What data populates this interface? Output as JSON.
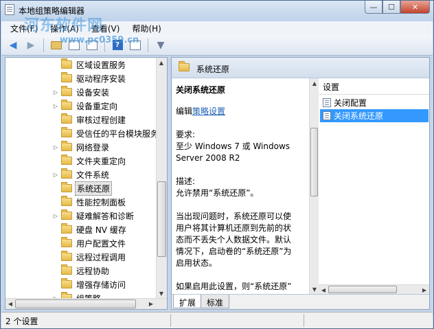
{
  "window": {
    "title": "本地组策略编辑器",
    "watermark": "河东软件网",
    "watermark_url": "www.pc0359.cn",
    "controls": {
      "minimize": "—",
      "maximize": "☐",
      "close": "✕"
    }
  },
  "menu": [
    "文件(F)",
    "操作(A)",
    "查看(V)",
    "帮助(H)"
  ],
  "toolbar": {
    "icons": [
      "back-arrow-icon",
      "forward-arrow-icon",
      "folder-up-icon",
      "show-hide-tree-icon",
      "properties-icon",
      "help-icon",
      "show-pane-icon",
      "filter-icon"
    ]
  },
  "tree": {
    "items": [
      {
        "label": "区域设置服务",
        "expandable": false
      },
      {
        "label": "驱动程序安装",
        "expandable": false
      },
      {
        "label": "设备安装",
        "expandable": true
      },
      {
        "label": "设备重定向",
        "expandable": true
      },
      {
        "label": "审核过程创建",
        "expandable": false
      },
      {
        "label": "受信任的平台模块服务",
        "expandable": false
      },
      {
        "label": "网络登录",
        "expandable": true
      },
      {
        "label": "文件夹重定向",
        "expandable": false
      },
      {
        "label": "文件系统",
        "expandable": true
      },
      {
        "label": "系统还原",
        "expandable": false,
        "selected": true
      },
      {
        "label": "性能控制面板",
        "expandable": false
      },
      {
        "label": "疑难解答和诊断",
        "expandable": true
      },
      {
        "label": "硬盘 NV 缓存",
        "expandable": false
      },
      {
        "label": "用户配置文件",
        "expandable": false
      },
      {
        "label": "远程过程调用",
        "expandable": false
      },
      {
        "label": "远程协助",
        "expandable": false
      },
      {
        "label": "增强存储访问",
        "expandable": false
      },
      {
        "label": "组策略",
        "expandable": true
      }
    ]
  },
  "right_pane": {
    "header": "系统还原",
    "description": {
      "title": "关闭系统还原",
      "edit_prefix": "编辑",
      "edit_link": "策略设置",
      "requirements_label": "要求:",
      "requirements": "至少 Windows 7 或 Windows Server 2008 R2",
      "description_label": "描述:",
      "description_text": "允许禁用“系统还原”。",
      "detail": "当出现问题时，系统还原可以使用户将其计算机还原到先前的状态而不丢失个人数据文件。默认情况下，启动卷的“系统还原”为启用状态。",
      "detail2": "如果启用此设置，则“系统还原”"
    },
    "list": {
      "header": "设置",
      "items": [
        {
          "label": "关闭配置",
          "selected": false
        },
        {
          "label": "关闭系统还原",
          "selected": true
        }
      ]
    },
    "tabs": [
      {
        "label": "扩展",
        "active": true
      },
      {
        "label": "标准",
        "active": false
      }
    ]
  },
  "status": {
    "text": "2 个设置"
  }
}
